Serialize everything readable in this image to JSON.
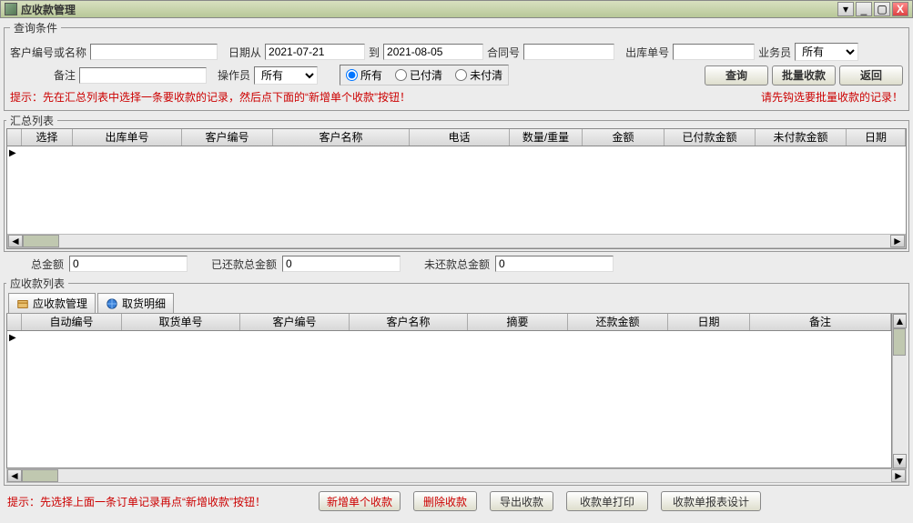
{
  "window": {
    "title": "应收款管理"
  },
  "query": {
    "legend": "查询条件",
    "customer_label": "客户编号或名称",
    "customer_value": "",
    "date_from_label": "日期从",
    "date_from_value": "2021-07-21",
    "date_to_label": "到",
    "date_to_value": "2021-08-05",
    "contract_label": "合同号",
    "contract_value": "",
    "outbound_label": "出库单号",
    "outbound_value": "",
    "salesman_label": "业务员",
    "salesman_value": "所有",
    "remark_label": "备注",
    "remark_value": "",
    "operator_label": "操作员",
    "operator_value": "所有",
    "radio": {
      "all": "所有",
      "paid": "已付清",
      "unpaid": "未付清"
    },
    "btn_query": "查询",
    "btn_batch": "批量收款",
    "btn_back": "返回"
  },
  "hints": {
    "left": "提示：先在汇总列表中选择一条要收款的记录，然后点下面的“新增单个收款”按钮！",
    "right": "请先钩选要批量收款的记录！",
    "bottom": "提示：先选择上面一条订单记录再点“新增收款”按钮！"
  },
  "summary": {
    "legend": "汇总列表",
    "cols": [
      "选择",
      "出库单号",
      "客户编号",
      "客户名称",
      "电话",
      "数量/重量",
      "金额",
      "已付款金额",
      "未付款金额",
      "日期"
    ]
  },
  "totals": {
    "total_label": "总金额",
    "total_value": "0",
    "repaid_label": "已还款总金额",
    "repaid_value": "0",
    "unrepaid_label": "未还款总金额",
    "unrepaid_value": "0"
  },
  "receivable": {
    "legend": "应收款列表",
    "tabs": {
      "manage": "应收款管理",
      "detail": "取货明细"
    },
    "cols": [
      "自动编号",
      "取货单号",
      "客户编号",
      "客户名称",
      "摘要",
      "还款金额",
      "日期",
      "备注"
    ]
  },
  "footer": {
    "btn_new": "新增单个收款",
    "btn_delete": "删除收款",
    "btn_export": "导出收款",
    "btn_print": "收款单打印",
    "btn_report": "收款单报表设计"
  }
}
